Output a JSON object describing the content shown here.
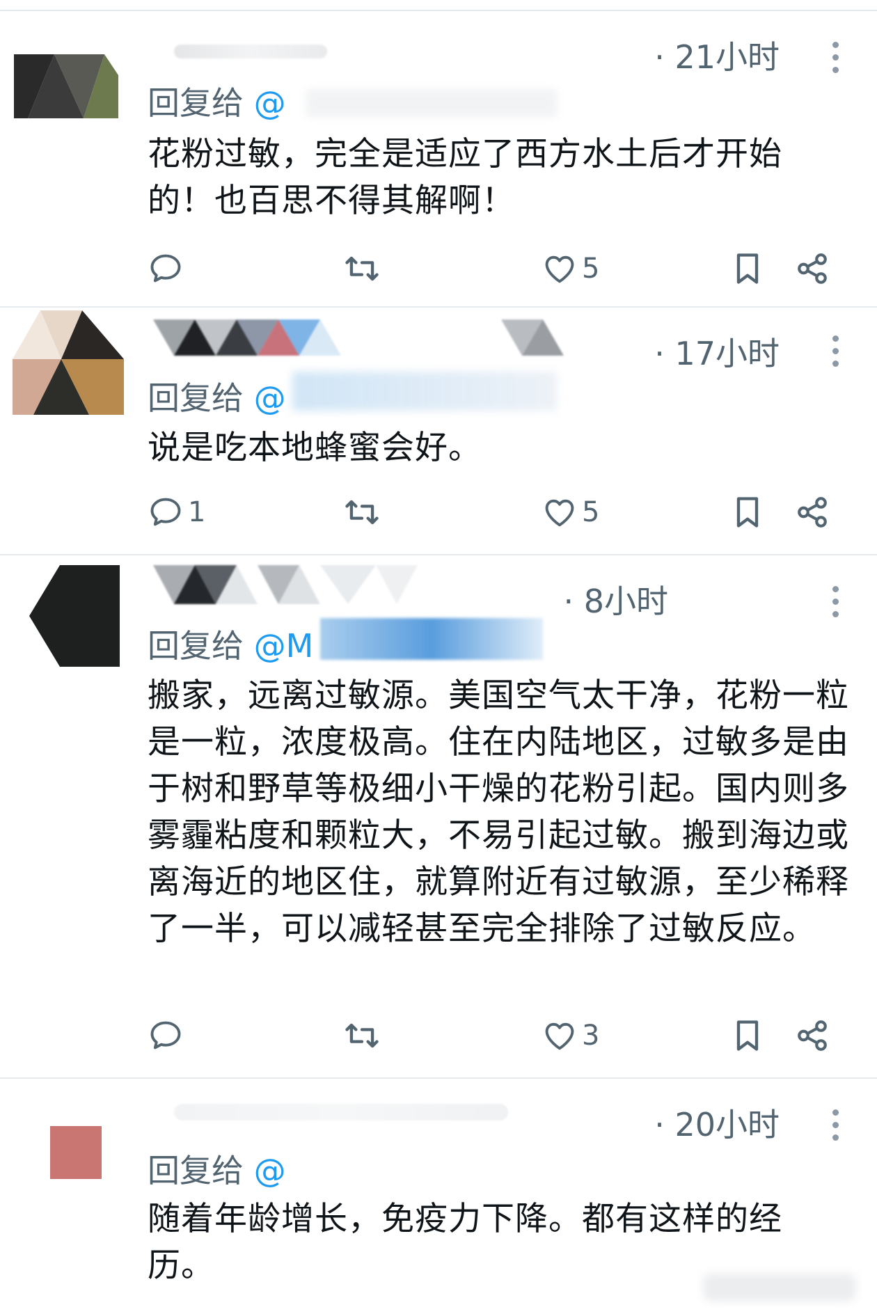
{
  "replies": [
    {
      "time": "21小时",
      "reply_label": "回复给",
      "handle": "@",
      "text": "花粉过敏，完全是适应了西方水土后才开始的！也百思不得其解啊！",
      "comments": "",
      "retweets": "",
      "likes": "5"
    },
    {
      "time": "17小时",
      "reply_label": "回复给",
      "handle": "@",
      "text": "说是吃本地蜂蜜会好。",
      "comments": "1",
      "retweets": "",
      "likes": "5"
    },
    {
      "time": "8小时",
      "reply_label": "回复给",
      "handle": "@M",
      "text": "搬家，远离过敏源。美国空气太干净，花粉一粒是一粒，浓度极高。住在内陆地区，过敏多是由于树和野草等极细小干燥的花粉引起。国内则多雾霾粘度和颗粒大，不易引起过敏。搬到海边或离海近的地区住，就算附近有过敏源，至少稀释了一半，可以减轻甚至完全排除了过敏反应。",
      "comments": "",
      "retweets": "",
      "likes": "3"
    },
    {
      "time": "20小时",
      "reply_label": "回复给",
      "handle": "@",
      "text": "随着年龄增长，免疫力下降。都有这样的经历。",
      "comments": "",
      "retweets": "",
      "likes": ""
    }
  ],
  "colors": {
    "text": "#0f1419",
    "secondary": "#536471",
    "link": "#1d9bf0",
    "divider": "#e8ebee"
  },
  "icons": [
    "reply-icon",
    "retweet-icon",
    "like-icon",
    "bookmark-icon",
    "share-icon",
    "more-icon"
  ]
}
